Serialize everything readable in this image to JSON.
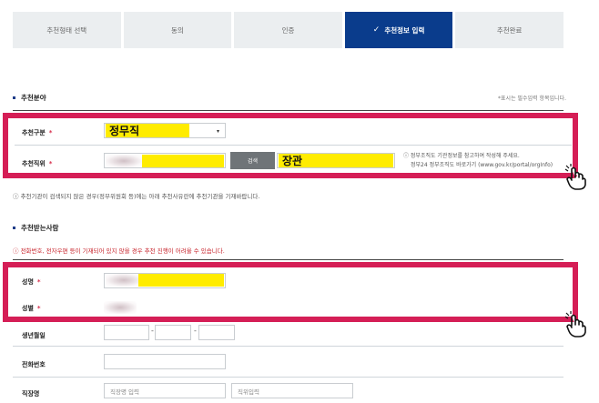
{
  "steps": [
    {
      "label": "추천형태 선택",
      "active": false
    },
    {
      "label": "동의",
      "active": false
    },
    {
      "label": "인증",
      "active": false
    },
    {
      "label": "추천정보 입력",
      "active": true
    },
    {
      "label": "추천완료",
      "active": false
    }
  ],
  "section1": {
    "title": "추천분야",
    "required_note": "*표시는 필수입력 항목입니다.",
    "category_label": "추천구분",
    "category_value": "정무직",
    "position_label": "추천직위",
    "search_button": "검색",
    "position_value": "장관",
    "help_line1": "ⓘ 정부조직도 기관정보를 참고하여 작성해 주세요.",
    "help_line2": "정부24 정부조직도 바로가기 (www.gov.kr/portal/orgInfo)",
    "note": "ⓘ 추천기관이 검색되지 않은 경우(정부위원회 등)에는 아래 추천사유란에 추천기관을 기재바랍니다."
  },
  "section2": {
    "title": "추천받는사람",
    "warning": "ⓘ 전화번호, 전자우편 등이 기재되어 있지 않을 경우 추천 진행이 어려울 수 있습니다.",
    "name_label": "성명",
    "gender_label": "성별",
    "birth_label": "생년월일",
    "phone_label": "전화번호",
    "work_label": "직장명",
    "work_placeholder": "직장명 입력",
    "position_placeholder": "직위입력"
  },
  "colors": {
    "active_tab": "#0a3c8c",
    "highlight_box": "#d51e56",
    "marker": "#ffec00",
    "required_star": "#d62d4b"
  }
}
